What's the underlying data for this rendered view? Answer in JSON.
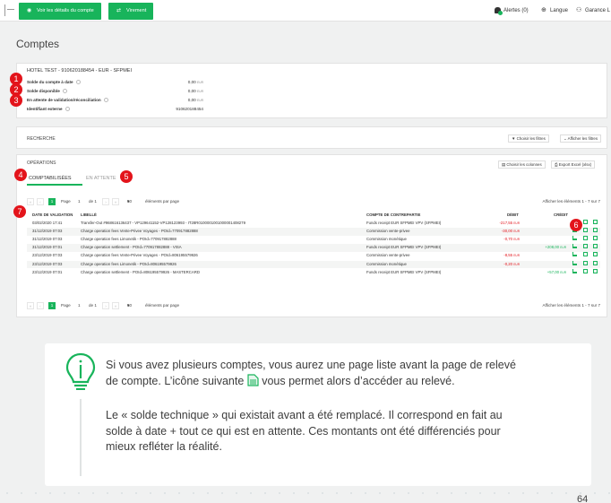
{
  "topbar": {
    "btn_details": "Voir les détails du compte",
    "btn_transfer": "Virement",
    "alerts": "Alertes (0)",
    "language": "Langue",
    "user": "Garance L"
  },
  "page_title": "Comptes",
  "account": {
    "title": "HOTEL TEST - 910620188454 - EUR - SFPMEI",
    "rows": [
      {
        "label": "Solde du compte à date",
        "value": "0,00",
        "unit": "EUR"
      },
      {
        "label": "Solde disponible",
        "value": "0,00",
        "unit": "EUR"
      },
      {
        "label": "En attente de validation/réconciliation",
        "value": "0,00",
        "unit": "EUR"
      },
      {
        "label": "Identifiant externe",
        "value": "910620188454",
        "unit": ""
      }
    ]
  },
  "search": {
    "label": "RECHERCHE",
    "btn_filters": "Choisir les filtres",
    "btn_show_filters": "Afficher les filtres"
  },
  "operations": {
    "title": "OPÉRATIONS",
    "btn_columns": "Choisir les colonnes",
    "btn_export": "Export Excel (xlsx)",
    "tab_booked": "COMPTABILISÉES",
    "tab_pending": "EN ATTENTE",
    "pager": {
      "page_label": "Page",
      "page": "1",
      "of": "de 1",
      "per_page": "50",
      "per_page_label": "éléments par page",
      "summary": "Afficher les éléments 1 - 7 sur 7"
    },
    "columns": {
      "date": "DATE DE VALIDATION",
      "label": "LIBELLÉ",
      "counterparty": "COMPTE DE CONTREPARTIE",
      "debit": "DÉBIT",
      "credit": "CRÉDIT"
    },
    "rows": [
      {
        "date": "03/02/2020 17:41",
        "label": "Transfer-Out #968616136437 - VP129641152-VP128123993 - IT28R0100001001000001408279",
        "counterparty": "Funds receipt EUR SFPMEI VPV (SFPMEI)",
        "debit": "-217,55",
        "debit_unit": "EUR",
        "credit": "",
        "credit_unit": ""
      },
      {
        "date": "31/12/2019 07:03",
        "label": "Charge operation fees Vente-Privee Voyages - POId=770917882888",
        "counterparty": "Commission vente-privee",
        "debit": "-30,00",
        "debit_unit": "EUR",
        "credit": "",
        "credit_unit": ""
      },
      {
        "date": "31/12/2019 07:03",
        "label": "Charge operation fees Limonetik - POId=770917882888",
        "counterparty": "Commission monétique",
        "debit": "-0,70",
        "debit_unit": "EUR",
        "credit": "",
        "credit_unit": ""
      },
      {
        "date": "31/12/2019 07:01",
        "label": "Charge operation settlement - POId=770917882888 - VISA",
        "counterparty": "Funds receipt EUR SFPMEI VPV (SFPMEI)",
        "debit": "",
        "debit_unit": "",
        "credit": "+208,00",
        "credit_unit": "EUR"
      },
      {
        "date": "23/12/2019 07:03",
        "label": "Charge operation fees Vente-Privee Voyages - POId=806195579926",
        "counterparty": "Commission vente-privee",
        "debit": "-8,55",
        "debit_unit": "EUR",
        "credit": "",
        "credit_unit": ""
      },
      {
        "date": "23/12/2019 07:03",
        "label": "Charge operation fees Limonetik - POId=806195579926",
        "counterparty": "Commission monétique",
        "debit": "-0,20",
        "debit_unit": "EUR",
        "credit": "",
        "credit_unit": ""
      },
      {
        "date": "23/12/2019 07:01",
        "label": "Charge operation settlement - POId=806195579926 - MASTERCARD",
        "counterparty": "Funds receipt EUR SFPMEI VPV (SFPMEI)",
        "debit": "",
        "debit_unit": "",
        "credit": "+57,00",
        "credit_unit": "EUR"
      }
    ]
  },
  "badges": [
    "1",
    "2",
    "3",
    "4",
    "5",
    "6",
    "7"
  ],
  "info": {
    "p1a": "Si vous avez plusieurs comptes, vous aurez une page liste avant la page de relevé",
    "p1b_pre": "de compte. L’icône  suivante ",
    "p1b_post": " vous permet alors d’accéder au relevé.",
    "p2a": "Le « solde technique » qui existait avant a été remplacé. Il correspond en fait au",
    "p2b": "solde à date + tout ce qui est en attente. Ces montants ont été différenciés pour",
    "p2c": "mieux refléter la réalité."
  },
  "page_number": "64",
  "colors": {
    "brand_green": "#18b45b",
    "badge_red": "#e3141b",
    "negative": "#e3141b"
  }
}
